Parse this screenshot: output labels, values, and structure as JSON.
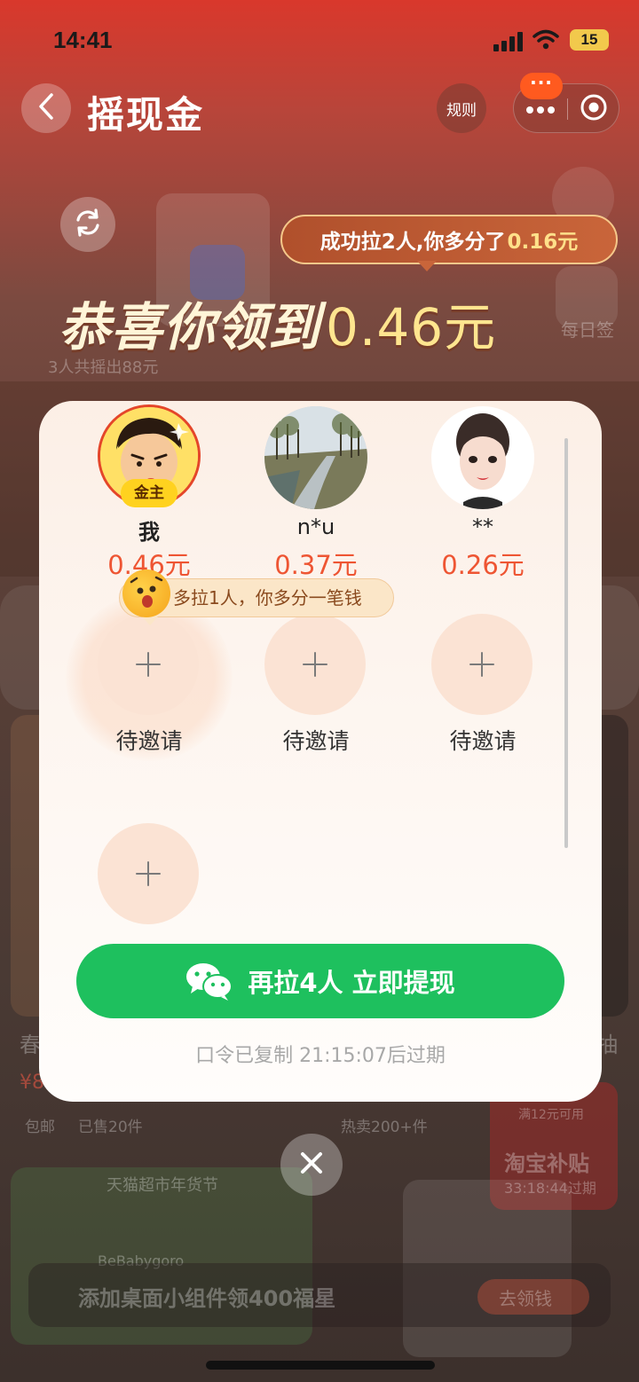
{
  "status_bar": {
    "time": "14:41",
    "battery": "15"
  },
  "header": {
    "title": "摇现金",
    "rules_label": "规则",
    "notification_badge": "···"
  },
  "hero": {
    "bonus_prefix": "成功拉2人,你多分了",
    "bonus_amount": "0.16元",
    "congrats_text": "恭喜你领到",
    "congrats_amount": "0.46元"
  },
  "background": {
    "shake_count_text": "3人共摇出88元",
    "daily_sign": "每日签",
    "card_title_left": "春",
    "price_left": "¥8",
    "tag_free_shipping": "包邮",
    "sold_count": "已售20件",
    "hot_sale": "热卖200+件",
    "right_label": "抽",
    "coupon_text": "满12元可用",
    "subsidy_title": "淘宝补贴",
    "subsidy_expire": "33:18:44过期",
    "tmall_section": "天猫超市年货节",
    "brand": "BeBabygoro",
    "widget_banner": "添加桌面小组件领400福星",
    "widget_button": "去领钱"
  },
  "modal": {
    "members": [
      {
        "name": "我",
        "amount": "0.46元",
        "badge": "金主"
      },
      {
        "name": "n*u",
        "amount": "0.37元"
      },
      {
        "name": "**",
        "amount": "0.26元"
      }
    ],
    "tip_text": "多拉1人，你多分一笔钱",
    "invite_slots": [
      {
        "label": "待邀请"
      },
      {
        "label": "待邀请"
      },
      {
        "label": "待邀请"
      },
      {
        "label": ""
      }
    ],
    "cta_label": "再拉4人 立即提现",
    "expire_text": "口令已复制 21:15:07后过期"
  },
  "colors": {
    "accent_green": "#1ec05e",
    "amount_red": "#ee5533",
    "gold": "#ffd21f"
  },
  "icons": [
    "back-icon",
    "more-icon",
    "target-icon",
    "refresh-icon",
    "wechat-icon",
    "close-icon",
    "plus-icon",
    "emoji-icon"
  ]
}
